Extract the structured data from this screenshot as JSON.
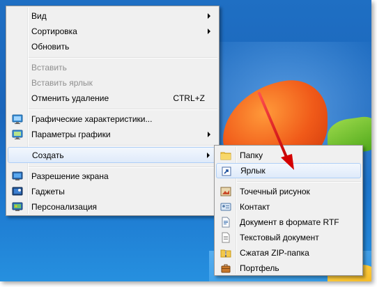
{
  "main_menu": {
    "items": [
      {
        "label": "Вид"
      },
      {
        "label": "Сортировка"
      },
      {
        "label": "Обновить"
      },
      {
        "label": "Вставить"
      },
      {
        "label": "Вставить ярлык"
      },
      {
        "label": "Отменить удаление",
        "shortcut": "CTRL+Z"
      },
      {
        "label": "Графические характеристики..."
      },
      {
        "label": "Параметры графики"
      },
      {
        "label": "Создать"
      },
      {
        "label": "Разрешение экрана"
      },
      {
        "label": "Гаджеты"
      },
      {
        "label": "Персонализация"
      }
    ]
  },
  "sub_menu": {
    "items": [
      {
        "label": "Папку",
        "icon": "folder-icon"
      },
      {
        "label": "Ярлык",
        "icon": "shortcut-icon"
      },
      {
        "label": "Точечный рисунок",
        "icon": "bitmap-icon"
      },
      {
        "label": "Контакт",
        "icon": "contact-icon"
      },
      {
        "label": "Документ в формате RTF",
        "icon": "rtf-document-icon"
      },
      {
        "label": "Текстовый документ",
        "icon": "text-document-icon"
      },
      {
        "label": "Сжатая ZIP-папка",
        "icon": "zip-folder-icon"
      },
      {
        "label": "Портфель",
        "icon": "briefcase-icon"
      }
    ]
  },
  "colors": {
    "highlight_border": "#aecff7",
    "arrow": "#e01010",
    "disabled_text": "#8f8f8f"
  }
}
